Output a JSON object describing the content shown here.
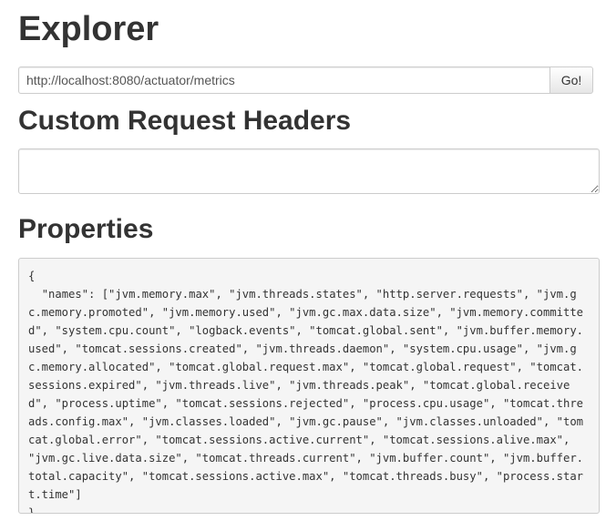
{
  "page": {
    "title": "Explorer"
  },
  "url_bar": {
    "value": "http://localhost:8080/actuator/metrics",
    "go_label": "Go!"
  },
  "custom_headers": {
    "heading": "Custom Request Headers",
    "value": ""
  },
  "properties": {
    "heading": "Properties",
    "json_text": "{\n  \"names\": [\"jvm.memory.max\", \"jvm.threads.states\", \"http.server.requests\", \"jvm.gc.memory.promoted\", \"jvm.memory.used\", \"jvm.gc.max.data.size\", \"jvm.memory.committed\", \"system.cpu.count\", \"logback.events\", \"tomcat.global.sent\", \"jvm.buffer.memory.used\", \"tomcat.sessions.created\", \"jvm.threads.daemon\", \"system.cpu.usage\", \"jvm.gc.memory.allocated\", \"tomcat.global.request.max\", \"tomcat.global.request\", \"tomcat.sessions.expired\", \"jvm.threads.live\", \"jvm.threads.peak\", \"tomcat.global.received\", \"process.uptime\", \"tomcat.sessions.rejected\", \"process.cpu.usage\", \"tomcat.threads.config.max\", \"jvm.classes.loaded\", \"jvm.gc.pause\", \"jvm.classes.unloaded\", \"tomcat.global.error\", \"tomcat.sessions.active.current\", \"tomcat.sessions.alive.max\", \"jvm.gc.live.data.size\", \"tomcat.threads.current\", \"jvm.buffer.count\", \"jvm.buffer.total.capacity\", \"tomcat.sessions.active.max\", \"tomcat.threads.busy\", \"process.start.time\"]\n}"
  }
}
